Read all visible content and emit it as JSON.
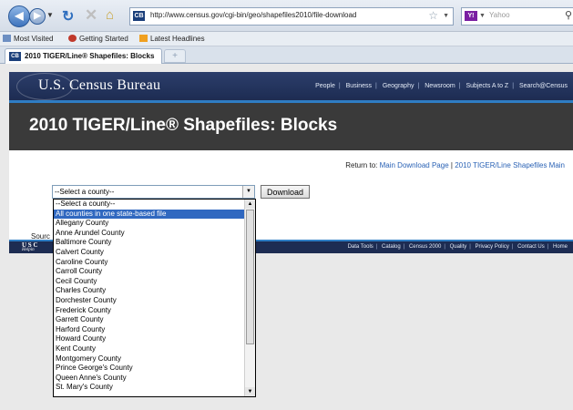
{
  "browser": {
    "url": "http://www.census.gov/cgi-bin/geo/shapefiles2010/file-download",
    "search_placeholder": "Yahoo",
    "search_engine_logo": "Y!",
    "favicon_text": "CB",
    "bookmarks": [
      "Most Visited",
      "Getting Started",
      "Latest Headlines"
    ],
    "tab_title": "2010 TIGER/Line® Shapefiles: Blocks",
    "new_tab_label": "+"
  },
  "header": {
    "logo": "U.S. Census Bureau",
    "nav": [
      "People",
      "Business",
      "Geography",
      "Newsroom",
      "Subjects A to Z",
      "Search@Census"
    ]
  },
  "page": {
    "title": "2010 TIGER/Line® Shapefiles: Blocks",
    "return_prefix": "Return to:",
    "return_links": [
      "Main Download Page",
      "2010 TIGER/Line Shapefiles Main"
    ],
    "select_value": "--Select a county--",
    "download_label": "Download",
    "source_text": "Sourc"
  },
  "footer": {
    "logo_line1": "U S C",
    "logo_line2": "Helpin",
    "nav": [
      "Data Tools",
      "Catalog",
      "Census 2000",
      "Quality",
      "Privacy Policy",
      "Contact Us",
      "Home"
    ]
  },
  "dropdown": {
    "selected_index": 1,
    "options": [
      "--Select a county--",
      "All counties in one state-based file",
      "Allegany County",
      "Anne Arundel County",
      "Baltimore County",
      "Calvert County",
      "Caroline County",
      "Carroll County",
      "Cecil County",
      "Charles County",
      "Dorchester County",
      "Frederick County",
      "Garrett County",
      "Harford County",
      "Howard County",
      "Kent County",
      "Montgomery County",
      "Prince George's County",
      "Queen Anne's County",
      "St. Mary's County"
    ]
  },
  "colors": {
    "header_bg": "#1d2c52",
    "accent_blue": "#2f7dc4",
    "title_bar_bg": "#3a3a3a",
    "link": "#2a62b5",
    "selection": "#3068c0"
  }
}
